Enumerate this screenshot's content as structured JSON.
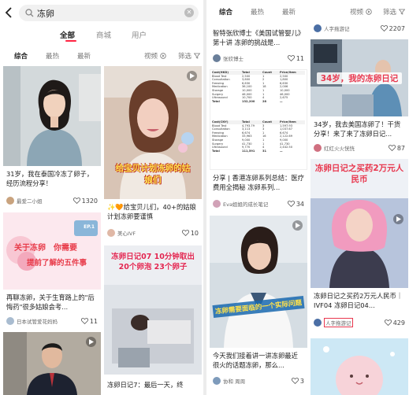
{
  "left": {
    "search": {
      "query": "冻卵"
    },
    "tabs": [
      "全部",
      "商城",
      "用户"
    ],
    "filters": {
      "items": [
        "综合",
        "最热",
        "最新"
      ],
      "video": "视频",
      "filter": "筛选"
    },
    "cards": [
      {
        "title": "31岁，我在泰国冷冻了卵子，经历流程分享！",
        "author": "最爱二小姐",
        "likes": "1320"
      },
      {
        "overlay": "给宝贝计划冻卵的姑娘们",
        "title": "✨🧡给宝贝儿们，40+的姑娘计划冻卵要谨慎",
        "author": "美心IVF",
        "likes": "10"
      },
      {
        "overlay_line1": "关于冻卵",
        "overlay_line2": "你需要",
        "overlay_line3": "提前了解的五件事",
        "badge": "EP.1",
        "title": "再聊冻卵，关于生育路上的\"后悔药\"很多姑娘会考...",
        "author": "日本试管爱花妈妈",
        "likes": "11"
      },
      {
        "overlay": "冻卵日记07 10分钟取出20个卵泡 23个卵子",
        "title": "冻卵日记7：最后一天，终"
      },
      {}
    ]
  },
  "right": {
    "filters": {
      "items": [
        "综合",
        "最热",
        "最新"
      ],
      "video": "视频",
      "filter": "筛选"
    },
    "cards": [
      {
        "title": "智特张欣博士《美国试管婴儿》第十讲 冻卵的挑战是...",
        "author": "张欣博士",
        "likes": "11"
      },
      {
        "table_hk": {
          "heading": "Cost(HKD)",
          "cols": [
            "Total",
            "Count",
            "Price/Item"
          ],
          "rows": [
            [
              "Blood Test",
              "2,500",
              "1",
              "2,500"
            ],
            [
              "Consultation",
              "3,600",
              "2",
              "1,800"
            ],
            [
              "Freezing",
              "6,630",
              "1",
              "6,630"
            ],
            [
              "Medication",
              "36,100",
              "18",
              "2,006"
            ],
            [
              "Storage",
              "10,000",
              "1",
              "10,000"
            ],
            [
              "Surgery",
              "46,000",
              "1",
              "46,000"
            ],
            [
              "Ultrasound",
              "10,700",
              "4",
              "2,675"
            ],
            [
              "Total",
              "132,200",
              "28",
              "—"
            ]
          ]
        },
        "table_cny": {
          "heading": "Cost(CNY)",
          "cols": [
            "Total",
            "Count",
            "Price/Item"
          ],
          "rows": [
            [
              "Blood Test",
              "4,793.79",
              "3",
              "1,597.93"
            ],
            [
              "Consultation",
              "3,113",
              "3",
              "1,037.67"
            ],
            [
              "Freezing",
              "6,674",
              "1",
              "6,674"
            ],
            [
              "Medication",
              "33,963",
              "16",
              "2,122.69"
            ],
            [
              "Storage",
              "9,000",
              "1",
              "9,000"
            ],
            [
              "Surgery",
              "41,730",
              "1",
              "41,730"
            ],
            [
              "Ultrasound",
              "9,770",
              "4",
              "2,442.50"
            ],
            [
              "Total",
              "111,591",
              "31",
              "—"
            ]
          ]
        },
        "title": "分享 | 香港冻卵系列总结：医疗费用全揭秘 冻卵系列...",
        "author": "Eva姐姐的成长笔记",
        "likes": "34"
      },
      {
        "overlay": "冻卵需要面临的一个实际问题",
        "title": "今天我们接着讲一讲冻卵最近很火的话题冻卵，那么...",
        "author": "协和 周周",
        "likes": "3"
      },
      {
        "author_top": "人字拖游记",
        "likes_top": "2207"
      },
      {
        "overlay": "34岁，我的冻卵日记",
        "title": "34岁，我去美国冻卵了！干货分享！来了来了冻卵日记...",
        "author": "红红火火恍恍",
        "likes": "87"
      },
      {
        "overlay": "冻卵日记之买药2万元人民币",
        "title": "冻卵日记之买药2万元人民币｜IVF04 冻卵日记04...",
        "author": "人字拖游记",
        "likes": "429"
      },
      {}
    ]
  },
  "colors": {
    "accent": "#ff2442",
    "overlay_red": "#e83c4a",
    "overlay_yellow": "#ffe14a"
  }
}
